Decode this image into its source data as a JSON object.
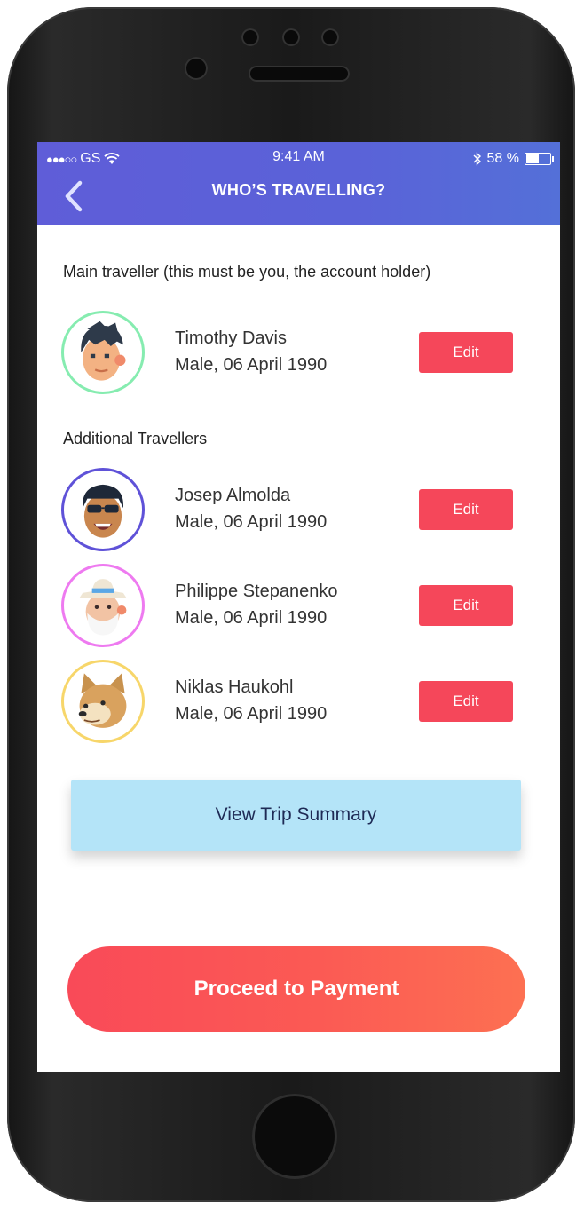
{
  "status_bar": {
    "carrier": "GS",
    "time": "9:41 AM",
    "battery": "58 %",
    "battery_level": 0.58
  },
  "header": {
    "title": "WHO’S TRAVELLING?",
    "back_icon": "chevron-left-icon"
  },
  "main_section": {
    "label": "Main traveller (this must be you, the account holder)"
  },
  "main_traveller": {
    "name": "Timothy Davis",
    "info": "Male, 06 April 1990",
    "edit_label": "Edit",
    "ring_color": "#86ecb0"
  },
  "additional_section": {
    "label": "Additional Travellers"
  },
  "additional_travellers": [
    {
      "name": "Josep Almolda",
      "info": "Male, 06 April 1990",
      "edit_label": "Edit",
      "ring_color": "#5f52d8"
    },
    {
      "name": "Philippe Stepanenko",
      "info": "Male, 06 April 1990",
      "edit_label": "Edit",
      "ring_color": "#ee7af0"
    },
    {
      "name": "Niklas Haukohl",
      "info": "Male, 06 April 1990",
      "edit_label": "Edit",
      "ring_color": "#f7d66a"
    }
  ],
  "actions": {
    "summary_label": "View Trip Summary",
    "payment_label": "Proceed to Payment"
  },
  "colors": {
    "header": "#5a62d8",
    "edit_button": "#f5475a",
    "summary_button": "#b4e4f8",
    "payment_gradient_start": "#f94a58",
    "payment_gradient_end": "#fd7052"
  }
}
